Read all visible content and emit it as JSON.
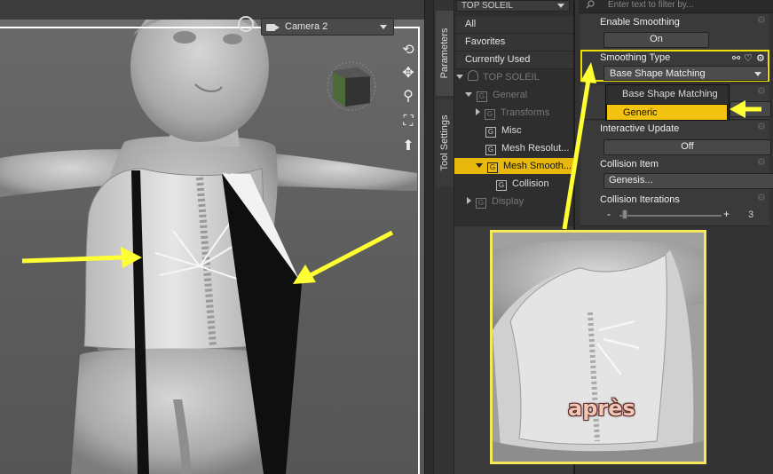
{
  "viewport": {
    "camera_label": "Camera 2"
  },
  "side_tabs": {
    "parameters": "Parameters",
    "tool_settings": "Tool Settings"
  },
  "scene_tree": {
    "filter_value": "TOP SOLEIL",
    "categories": [
      "All",
      "Favorites",
      "Currently Used"
    ],
    "root": "TOP SOLEIL",
    "nodes": {
      "general": "General",
      "transforms": "Transforms",
      "misc": "Misc",
      "mesh_resolution": "Mesh Resolut...",
      "mesh_smoothing": "Mesh Smooth...",
      "collision": "Collision",
      "display": "Display"
    },
    "node_badge": "G"
  },
  "parameters": {
    "search_placeholder": "Enter text to filter by...",
    "enable_smoothing": {
      "label": "Enable Smoothing",
      "value": "On"
    },
    "smoothing_type": {
      "label": "Smoothing Type",
      "value": "Base Shape Matching",
      "options": [
        "Base Shape Matching",
        "Generic"
      ],
      "highlighted": "Generic"
    },
    "interactive_update": {
      "label": "Interactive Update",
      "value": "Off"
    },
    "collision_item": {
      "label": "Collision Item",
      "value": "Genesis..."
    },
    "collision_iterations": {
      "label": "Collision Iterations",
      "minus": "-",
      "plus": "+",
      "value": "3",
      "slider_fraction": 0.05
    }
  },
  "inset": {
    "caption": "après"
  },
  "colors": {
    "highlight": "#e8b80c",
    "annotation_arrow": "#ffff33",
    "inset_frame": "#f5e85a"
  }
}
